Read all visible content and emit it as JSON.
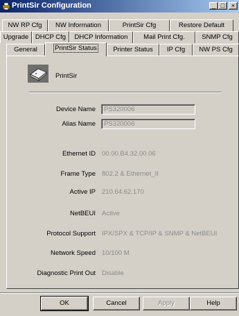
{
  "window": {
    "title": "PrintSir Configuration",
    "controls": {
      "minimize": "_",
      "maximize": "□",
      "close": "×"
    }
  },
  "tabs": {
    "row1": [
      "NW RP Cfg",
      "NW Information",
      "PrintSir Cfg",
      "Restore Default"
    ],
    "row2": [
      "Upgrade",
      "DHCP Cfg",
      "DHCP Information",
      "Mail Print Cfg.",
      "SNMP Cfg"
    ],
    "row3": [
      "General",
      "PrintSir Status",
      "Printer Status",
      "IP Cfg",
      "NW PS Cfg"
    ],
    "active": "PrintSir Status"
  },
  "device": {
    "name_label": "PrintSir",
    "icon": "printer-icon"
  },
  "fields": {
    "device_name": {
      "label": "Device Name",
      "value": "PS320006"
    },
    "alias_name": {
      "label": "Alias Name",
      "value": "PS320006"
    }
  },
  "info": {
    "ethernet_id": {
      "label": "Ethernet ID",
      "value": "00.00.B4.32.00.06"
    },
    "frame_type": {
      "label": "Frame Type",
      "value": "802.2 & Ethernet_II"
    },
    "active_ip": {
      "label": "Active IP",
      "value": "210.64.62.170"
    },
    "netbeui": {
      "label": "NetBEUI",
      "value": "Active"
    },
    "protocol_support": {
      "label": "Protocol Support",
      "value": "IPX/SPX & TCP/IP & SNMP & NetBEUI"
    },
    "network_speed": {
      "label": "Network Speed",
      "value": "10/100 M"
    },
    "diagnostic_print_out": {
      "label": "Diagnostic Print Out",
      "value": "Disable"
    }
  },
  "buttons": {
    "ok": "OK",
    "cancel": "Cancel",
    "apply": "Apply",
    "help": "Help"
  }
}
